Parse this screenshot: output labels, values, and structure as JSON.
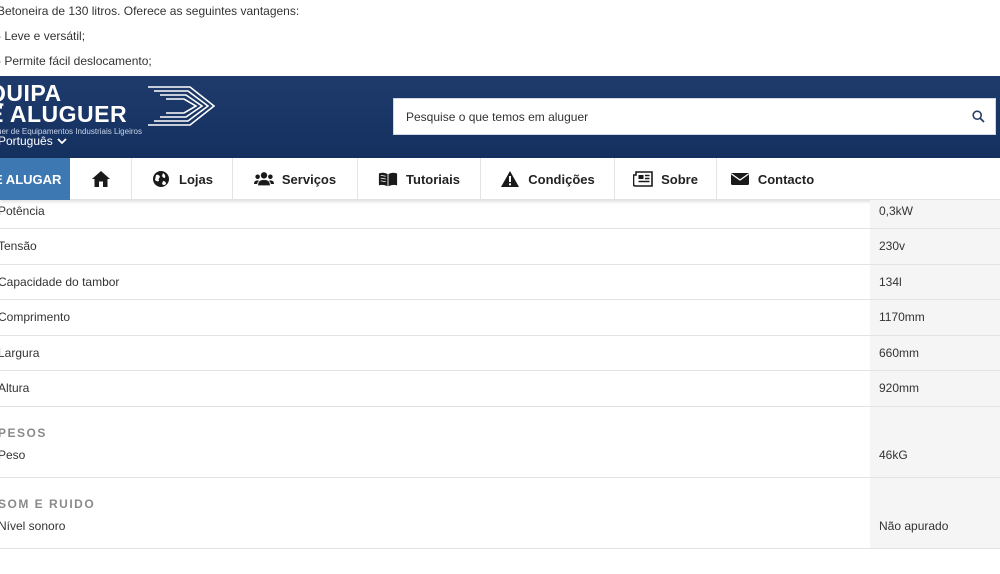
{
  "intro": {
    "lines": [
      "Betoneira de 130 litros. Oferece as seguintes vantagens:",
      "- Leve e versátil;",
      "- Permite fácil deslocamento;"
    ]
  },
  "header": {
    "logo_line1": "QUIPA",
    "logo_line2": "E ALUGUER",
    "logo_sub": "uer de Equipamentos Industriais Ligeiros",
    "language": "Português",
    "search_placeholder": "Pesquise o que temos em aluguer"
  },
  "nav": {
    "alugar": "E ALUGAR",
    "lojas": "Lojas",
    "servicos": "Serviços",
    "tutoriais": "Tutoriais",
    "condicoes": "Condições",
    "sobre": "Sobre",
    "contacto": "Contacto"
  },
  "specs": {
    "rows": [
      {
        "label": "Potência",
        "value": "0,3kW"
      },
      {
        "label": "Tensão",
        "value": "230v"
      },
      {
        "label": "Capacidade do tambor",
        "value": "134l"
      },
      {
        "label": "Comprimento",
        "value": "1170mm"
      },
      {
        "label": "Largura",
        "value": "660mm"
      },
      {
        "label": "Altura",
        "value": "920mm"
      }
    ],
    "groups": [
      {
        "title": "PESOS",
        "label": "Peso",
        "value": "46kG"
      },
      {
        "title": "SOM E RUIDO",
        "label": "Nível sonoro",
        "value": "Não apurado"
      }
    ]
  },
  "colors": {
    "header_bg": "#1a3666",
    "nav_active_bg": "#3d78b3",
    "value_cell_bg": "#f5f5f5"
  }
}
